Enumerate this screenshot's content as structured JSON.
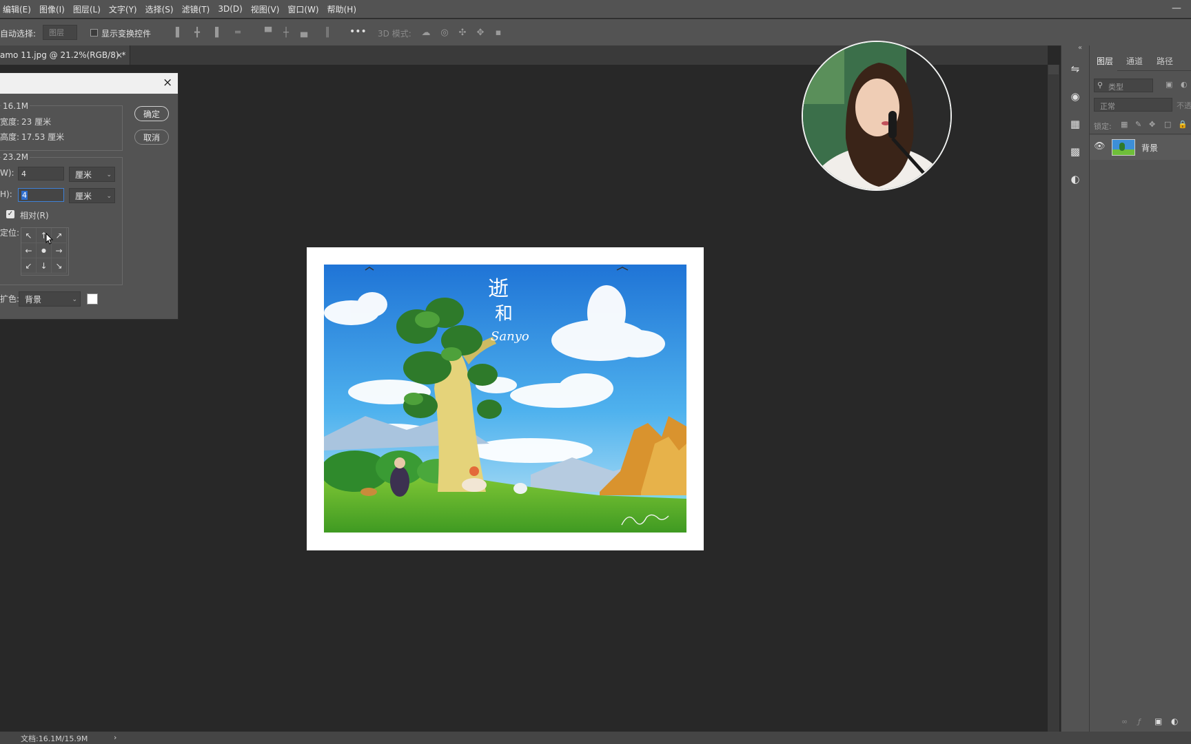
{
  "menu": [
    "编辑(E)",
    "图像(I)",
    "图层(L)",
    "文字(Y)",
    "选择(S)",
    "滤镜(T)",
    "3D(D)",
    "视图(V)",
    "窗口(W)",
    "帮助(H)"
  ],
  "options": {
    "auto_select_label": "自动选择:",
    "layer_dropdown": "图层",
    "show_transform_label": "显示变换控件",
    "more": "•••",
    "mode_3d_label": "3D 模式:"
  },
  "document_tab": {
    "title": "amo 11.jpg @ 21.2%(RGB/8) *",
    "close": "×"
  },
  "dialog": {
    "close": "×",
    "current_size": "16.1M",
    "current_width_label": "宽度:",
    "current_width_value": "23 厘米",
    "current_height_label": "高度:",
    "current_height_value": "17.53 厘米",
    "ok_label": "确定",
    "cancel_label": "取消",
    "new_size": "23.2M",
    "width_label": "W):",
    "width_value": "4",
    "width_unit": "厘米",
    "height_label": "H):",
    "height_value": "4",
    "height_unit": "厘米",
    "relative_label": "相对(R)",
    "relative_checked": true,
    "anchor_label": "定位:",
    "anchor_arrows": [
      "↖",
      "↑",
      "↗",
      "←",
      "●",
      "→",
      "↙",
      "↓",
      "↘"
    ],
    "ext_color_label": "扩色:",
    "ext_color_value": "背景"
  },
  "artwork": {
    "title_text": "逝",
    "title_text2": "和",
    "script_text": "Sanyo"
  },
  "panels": {
    "tabs": [
      "图层",
      "通道",
      "路径"
    ],
    "filter_placeholder": "类型",
    "blend_mode": "正常",
    "opacity_label": "不透",
    "lock_label": "锁定:",
    "layer_name": "背景"
  },
  "status": {
    "doc_info": "文档:16.1M/15.9M",
    "arrow": "›"
  },
  "colors": {
    "panel": "#535353",
    "canvas": "#282828",
    "sky": "#2f8fe0"
  }
}
